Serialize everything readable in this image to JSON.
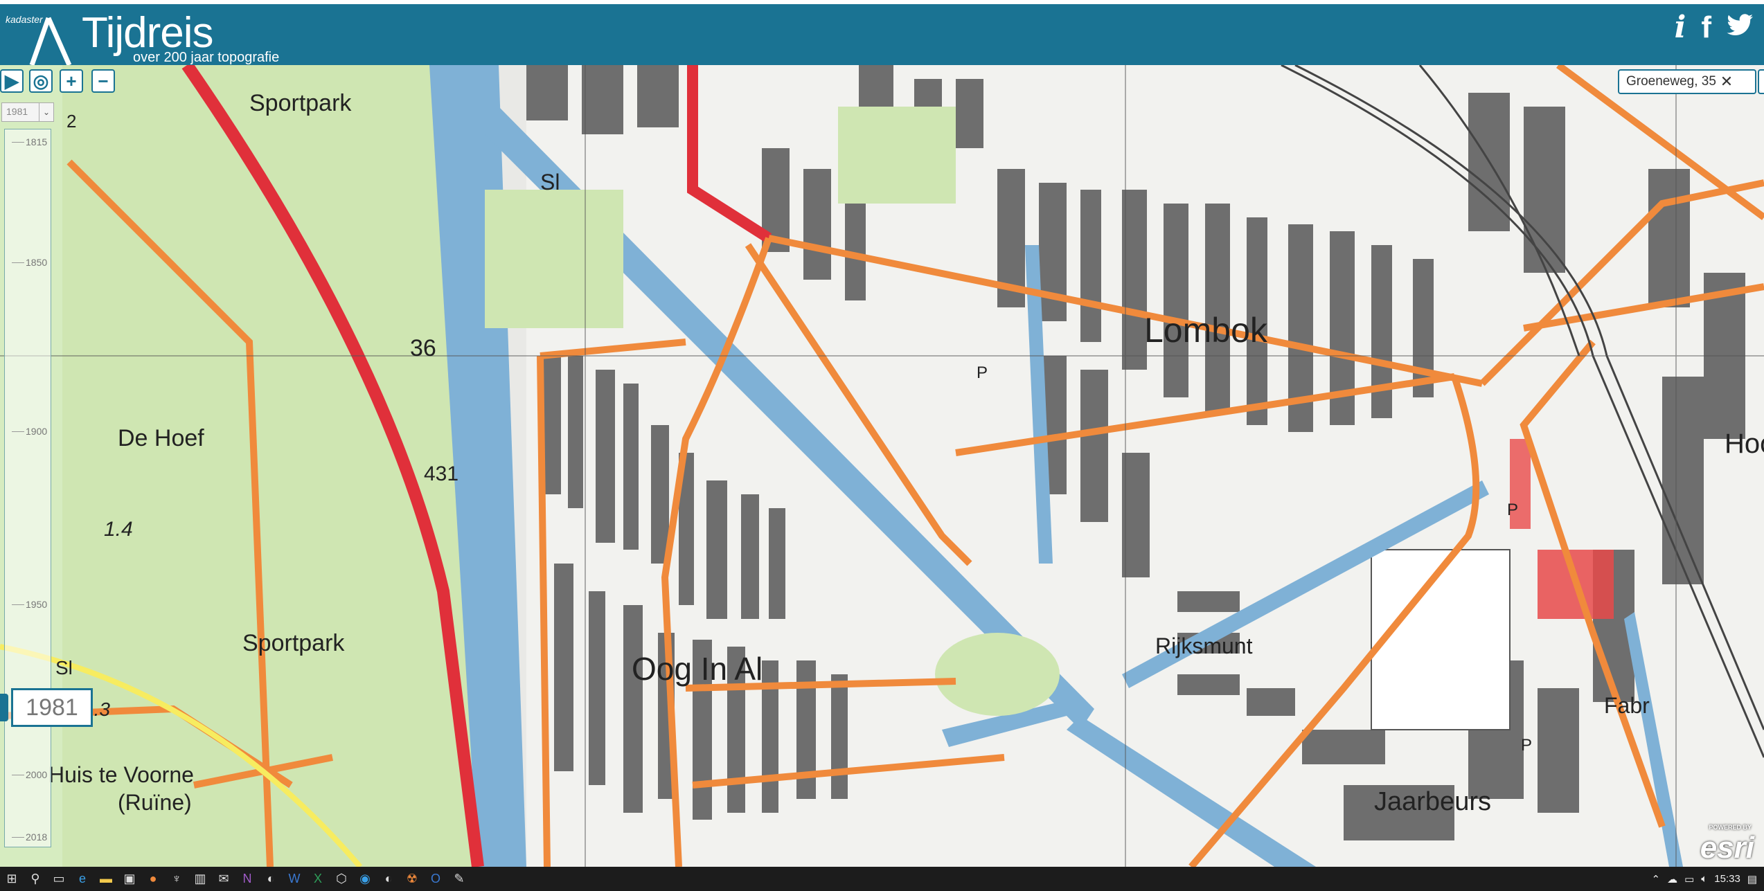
{
  "header": {
    "brand": "kadaster",
    "title": "Tijdreis",
    "subtitle": "over 200 jaar topografie",
    "icons": [
      "info-icon",
      "facebook-icon",
      "twitter-icon"
    ]
  },
  "controls": {
    "play": "▶",
    "locate": "◎",
    "zoom_in": "+",
    "zoom_out": "−",
    "year_select": "1981"
  },
  "timeline": {
    "ticks": [
      "1815",
      "1850",
      "1900",
      "1950",
      "2000",
      "2018"
    ],
    "current_year": "1981"
  },
  "search": {
    "value": "Groeneweg, 35",
    "clear": "✕"
  },
  "map_labels": {
    "sportpark_top": "Sportpark",
    "sl_top": "Sl",
    "n36": "36",
    "de_hoef": "De Hoef",
    "n431": "431",
    "n14": "1.4",
    "sportpark_bottom": "Sportpark",
    "sl_bottom": "Sl",
    "n13": "1.3",
    "huis_te_voorne": "Huis te Voorne",
    "ruine": "(Ruïne)",
    "n2": "2",
    "lombok": "Lombok",
    "oog_in_al": "Oog In Al",
    "rijksmunt": "Rijksmunt",
    "jaarbeurs": "Jaarbeurs",
    "fabr": "Fabr",
    "hoog": "Hoog",
    "p1": "P",
    "p2": "P",
    "p3": "P"
  },
  "attribution": {
    "powered": "POWERED BY",
    "logo": "esri"
  },
  "taskbar": {
    "time": "15:33",
    "icons": [
      "windows-icon",
      "search-icon",
      "task-view-icon",
      "edge-icon",
      "explorer-icon",
      "store-icon",
      "firefox-icon",
      "app-icon",
      "library-icon",
      "mail-icon",
      "onenote-icon",
      "steam-icon",
      "word-icon",
      "excel-icon",
      "app2-icon",
      "app3-icon",
      "steam2-icon",
      "app4-icon",
      "outlook-icon",
      "app5-icon"
    ]
  },
  "colors": {
    "accent": "#1a7393",
    "water": "#7fb1d6",
    "road_main": "#f08a3c",
    "highway": "#e0303a",
    "green": "#cfe8b4",
    "built": "#6b6b6b"
  }
}
